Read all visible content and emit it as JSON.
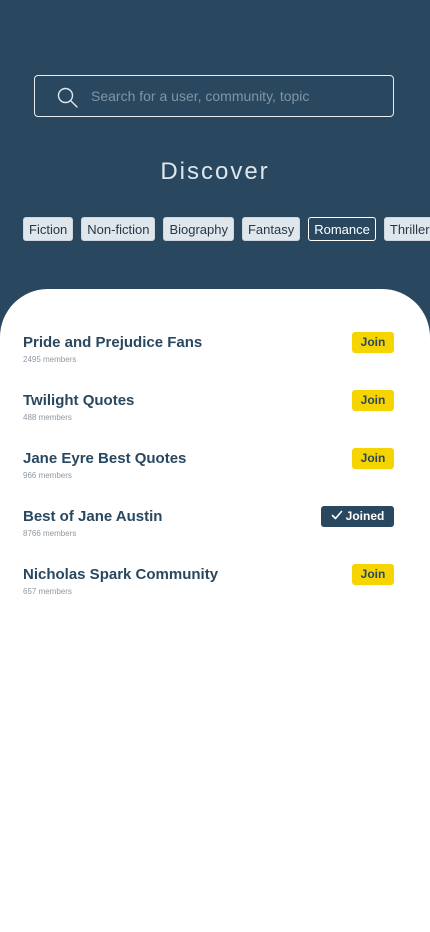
{
  "search": {
    "placeholder": "Search for a user, community, topic"
  },
  "page": {
    "title": "Discover"
  },
  "tags": [
    {
      "label": "Fiction",
      "selected": false
    },
    {
      "label": "Non-fiction",
      "selected": false
    },
    {
      "label": "Biography",
      "selected": false
    },
    {
      "label": "Fantasy",
      "selected": false
    },
    {
      "label": "Romance",
      "selected": true
    },
    {
      "label": "Thriller",
      "selected": false
    }
  ],
  "communities": [
    {
      "name": "Pride and Prejudice Fans",
      "members": "2495 members",
      "action": "Join",
      "joined": false
    },
    {
      "name": "Twilight Quotes",
      "members": "488 members",
      "action": "Join",
      "joined": false
    },
    {
      "name": "Jane Eyre Best Quotes",
      "members": "966 members",
      "action": "Join",
      "joined": false
    },
    {
      "name": "Best of Jane Austin",
      "members": "8766 members",
      "action": "Joined",
      "joined": true
    },
    {
      "name": "Nicholas Spark Community",
      "members": "657 members",
      "action": "Join",
      "joined": false
    }
  ],
  "icons": {
    "search": "search-icon",
    "joined_check": "check-icon"
  },
  "colors": {
    "header_background": "#294860",
    "accent_yellow": "#f5d400",
    "text_primary": "#294860",
    "text_muted": "#8d98a3",
    "tag_background": "#dfe7ed",
    "page_background": "#ffffff"
  }
}
